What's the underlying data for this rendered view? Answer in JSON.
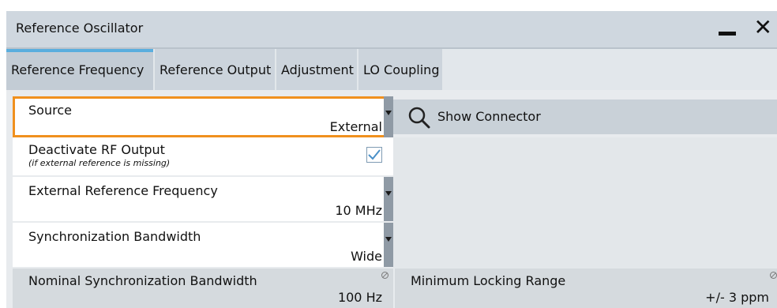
{
  "window": {
    "title": "Reference Oscillator",
    "minimize_icon": "minimize-icon",
    "close_glyph": "✕"
  },
  "tabs": [
    {
      "label": "Reference Frequency",
      "active": true
    },
    {
      "label": "Reference Output",
      "active": false
    },
    {
      "label": "Adjustment",
      "active": false
    },
    {
      "label": "LO Coupling",
      "active": false
    }
  ],
  "fields": {
    "source": {
      "label": "Source",
      "value": "External"
    },
    "deactivate_rf": {
      "label": "Deactivate RF Output",
      "note": "(if external reference is missing)",
      "checked": true
    },
    "ext_ref_freq": {
      "label": "External Reference Frequency",
      "value": "10 MHz"
    },
    "sync_bw": {
      "label": "Synchronization Bandwidth",
      "value": "Wide"
    },
    "nominal_sync_bw": {
      "label": "Nominal Synchronization Bandwidth",
      "value": "100 Hz"
    },
    "min_locking_range": {
      "label": "Minimum Locking Range",
      "value": "+/- 3 ppm"
    }
  },
  "show_connector": {
    "label": "Show Connector",
    "icon": "search-icon"
  },
  "colors": {
    "accent": "#f0901e",
    "tab_indicator": "#5aaede",
    "check": "#4a90c8"
  }
}
